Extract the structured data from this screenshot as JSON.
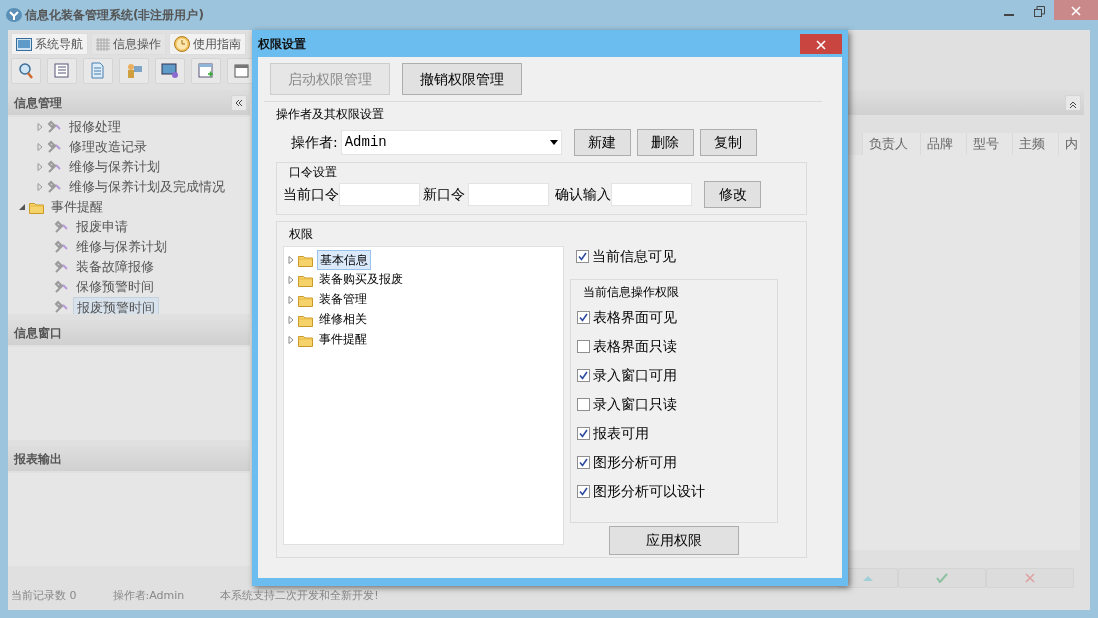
{
  "window": {
    "title": "信息化装备管理系统(非注册用户)"
  },
  "nav_tabs": [
    {
      "label": "系统导航",
      "selected": false,
      "kind": "monitor"
    },
    {
      "label": "信息操作",
      "selected": true,
      "kind": "grid"
    },
    {
      "label": "使用指南",
      "selected": false,
      "kind": "clock"
    }
  ],
  "sidebar": {
    "panels": [
      {
        "title": "信息管理",
        "tree": [
          {
            "label": "报修处理",
            "kind": "task",
            "expanded": false,
            "selected": false
          },
          {
            "label": "修理改造记录",
            "kind": "task",
            "expanded": false,
            "selected": false
          },
          {
            "label": "维修与保养计划",
            "kind": "task",
            "expanded": false,
            "selected": false
          },
          {
            "label": "维修与保养计划及完成情况",
            "kind": "task",
            "expanded": false,
            "selected": false
          },
          {
            "label": "事件提醒",
            "kind": "folder",
            "expanded": true,
            "selected": false,
            "children": [
              {
                "label": "报废申请",
                "selected": false
              },
              {
                "label": "维修与保养计划",
                "selected": false
              },
              {
                "label": "装备故障报修",
                "selected": false
              },
              {
                "label": "保修预警时间",
                "selected": false
              },
              {
                "label": "报废预警时间",
                "selected": true
              }
            ]
          }
        ]
      },
      {
        "title": "信息窗口"
      },
      {
        "title": "报表输出"
      }
    ]
  },
  "table": {
    "columns": [
      "负责人",
      "品牌",
      "型号",
      "主频",
      "内"
    ]
  },
  "status_bar": [
    "当前记录数 0",
    "操作者:Admin",
    "本系统支持二次开发和全新开发!"
  ],
  "dialog": {
    "title": "权限设置",
    "top_buttons": [
      {
        "label": "启动权限管理",
        "disabled": true
      },
      {
        "label": "撤销权限管理",
        "disabled": false
      }
    ],
    "operator_section": {
      "title": "操作者及其权限设置",
      "label": "操作者:",
      "value": "Admin",
      "buttons": [
        "新建",
        "删除",
        "复制"
      ]
    },
    "password_section": {
      "title": "口令设置",
      "fields": [
        {
          "label": "当前口令"
        },
        {
          "label": "新口令"
        },
        {
          "label": "确认输入"
        }
      ],
      "button": "修改"
    },
    "permissions": {
      "title": "权限",
      "tree": [
        {
          "label": "基本信息",
          "selected": true,
          "expanded": false
        },
        {
          "label": "装备购买及报废",
          "selected": false,
          "expanded": false
        },
        {
          "label": "装备管理",
          "selected": false,
          "expanded": false
        },
        {
          "label": "维修相关",
          "selected": false,
          "expanded": false
        },
        {
          "label": "事件提醒",
          "selected": false,
          "expanded": false
        }
      ],
      "visible": {
        "label": "当前信息可见",
        "checked": true
      },
      "operations": {
        "title": "当前信息操作权限",
        "items": [
          {
            "label": "表格界面可见",
            "checked": true
          },
          {
            "label": "表格界面只读",
            "checked": false
          },
          {
            "label": "录入窗口可用",
            "checked": true
          },
          {
            "label": "录入窗口只读",
            "checked": false
          },
          {
            "label": "报表可用",
            "checked": true
          },
          {
            "label": "图形分析可用",
            "checked": true
          },
          {
            "label": "图形分析可以设计",
            "checked": true
          }
        ]
      },
      "apply_button": "应用权限"
    }
  }
}
